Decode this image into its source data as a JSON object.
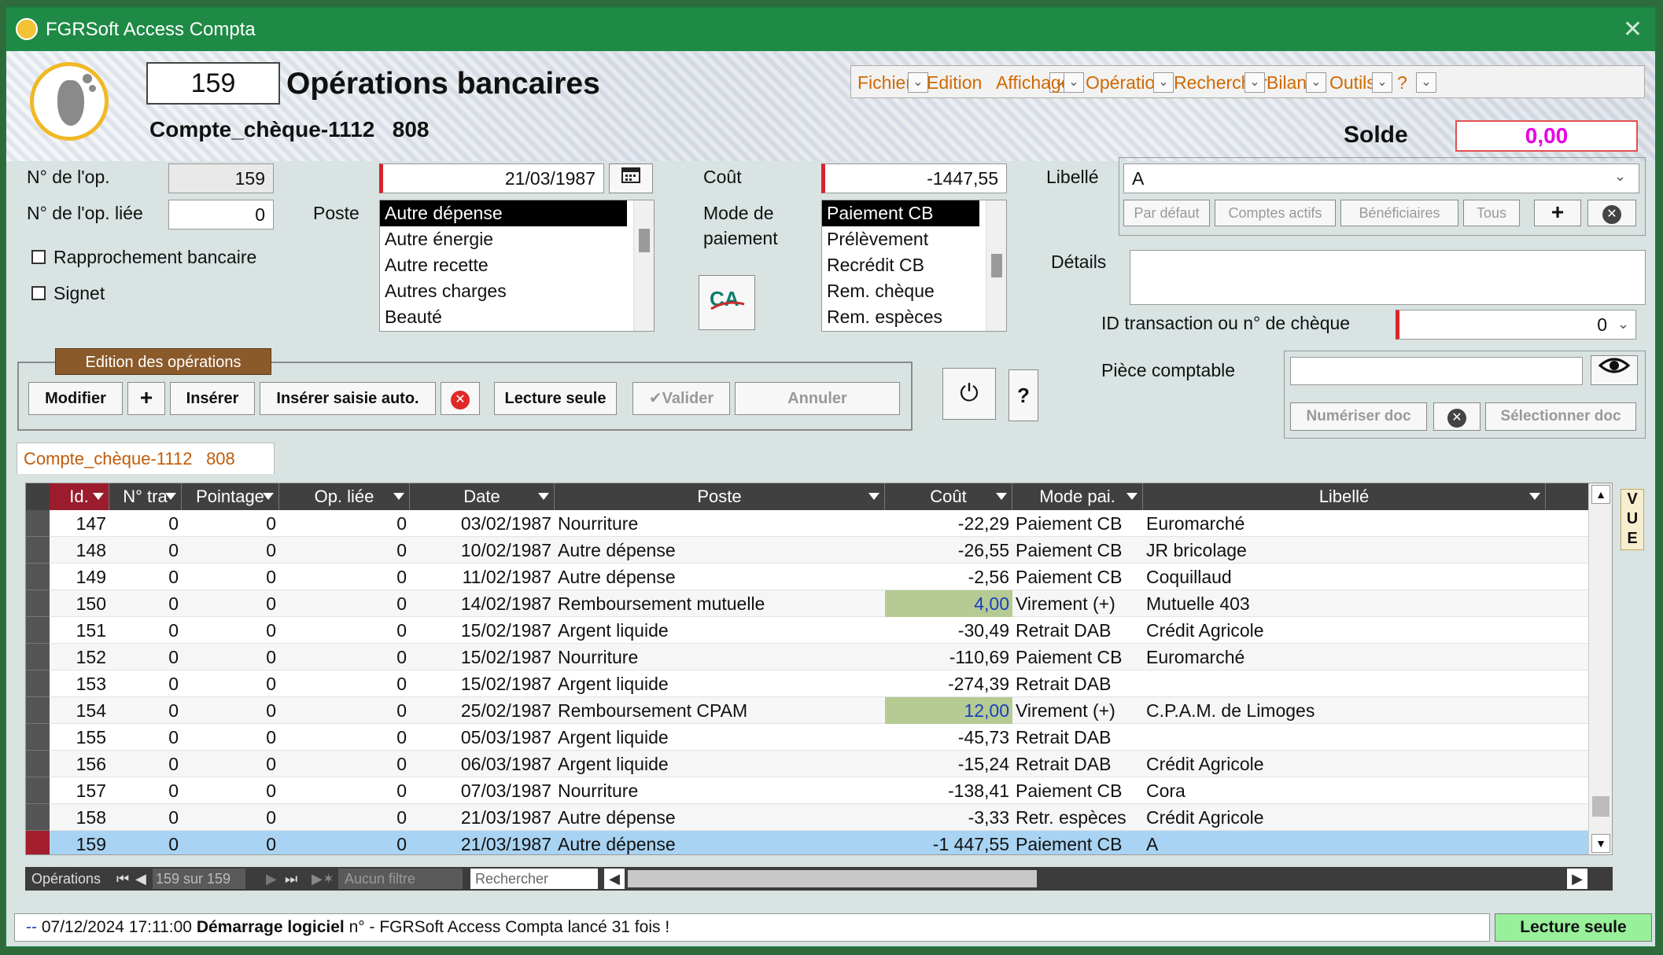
{
  "window": {
    "title": "FGRSoft Access Compta"
  },
  "header": {
    "op_number": "159",
    "title": "Opérations bancaires",
    "account": "Compte_chèque-1112    808",
    "solde_label": "Solde",
    "solde_value": "0,00"
  },
  "menu": [
    "Fichier",
    "Edition",
    "Affichage",
    "Opération",
    "Rechercher",
    "Bilans",
    "Outils",
    "?"
  ],
  "form": {
    "op_label": "N° de l'op.",
    "op_value": "159",
    "linked_label": "N° de l'op. liée",
    "linked_value": "0",
    "rapprochement_label": "Rapprochement bancaire",
    "signet_label": "Signet",
    "date_value": "21/03/1987",
    "poste_label": "Poste",
    "poste_items": [
      "Autre dépense",
      "Autre énergie",
      "Autre recette",
      "Autres charges",
      "Beauté"
    ],
    "cout_label": "Coût",
    "cout_value": "-1447,55",
    "mode_label_1": "Mode de",
    "mode_label_2": "paiement",
    "mode_items": [
      "Paiement CB",
      "Prélèvement",
      "Recrédit CB",
      "Rem. chèque",
      "Rem. espèces"
    ],
    "libelle_label": "Libellé",
    "libelle_value": "A",
    "libelle_buttons": [
      "Par défaut",
      "Comptes actifs",
      "Bénéficiaires",
      "Tous"
    ],
    "details_label": "Détails",
    "id_label": "ID transaction ou n° de chèque",
    "id_value": "0",
    "piece_label": "Pièce comptable",
    "numeriser": "Numériser doc",
    "selectionner": "Sélectionner doc"
  },
  "edit": {
    "group_title": "Edition des opérations",
    "modifier": "Modifier",
    "inserer": "Insérer",
    "inserer_auto": "Insérer saisie auto.",
    "lecture_seule": "Lecture seule",
    "valider": "Valider",
    "annuler": "Annuler",
    "help": "?"
  },
  "grid": {
    "tab_label": "Compte_chèque-1112    808",
    "columns": [
      "Id.",
      "N° tra",
      "Pointage",
      "Op. liée",
      "Date",
      "Poste",
      "Coût",
      "Mode pai.",
      "Libellé"
    ],
    "rows": [
      [
        "147",
        "0",
        "0",
        "0",
        "03/02/1987",
        "Nourriture",
        "-22,29",
        "Paiement CB",
        "Euromarché"
      ],
      [
        "148",
        "0",
        "0",
        "0",
        "10/02/1987",
        "Autre dépense",
        "-26,55",
        "Paiement CB",
        "JR bricolage"
      ],
      [
        "149",
        "0",
        "0",
        "0",
        "11/02/1987",
        "Autre dépense",
        "-2,56",
        "Paiement CB",
        "Coquillaud"
      ],
      [
        "150",
        "0",
        "0",
        "0",
        "14/02/1987",
        "Remboursement mutuelle",
        "4,00",
        "Virement (+)",
        "Mutuelle 403"
      ],
      [
        "151",
        "0",
        "0",
        "0",
        "15/02/1987",
        "Argent liquide",
        "-30,49",
        "Retrait DAB",
        "Crédit Agricole"
      ],
      [
        "152",
        "0",
        "0",
        "0",
        "15/02/1987",
        "Nourriture",
        "-110,69",
        "Paiement CB",
        "Euromarché"
      ],
      [
        "153",
        "0",
        "0",
        "0",
        "15/02/1987",
        "Argent liquide",
        "-274,39",
        "Retrait DAB",
        ""
      ],
      [
        "154",
        "0",
        "0",
        "0",
        "25/02/1987",
        "Remboursement CPAM",
        "12,00",
        "Virement (+)",
        "C.P.A.M. de Limoges"
      ],
      [
        "155",
        "0",
        "0",
        "0",
        "05/03/1987",
        "Argent liquide",
        "-45,73",
        "Retrait DAB",
        ""
      ],
      [
        "156",
        "0",
        "0",
        "0",
        "06/03/1987",
        "Argent liquide",
        "-15,24",
        "Retrait DAB",
        "Crédit Agricole"
      ],
      [
        "157",
        "0",
        "0",
        "0",
        "07/03/1987",
        "Nourriture",
        "-138,41",
        "Paiement CB",
        "Cora"
      ],
      [
        "158",
        "0",
        "0",
        "0",
        "21/03/1987",
        "Autre dépense",
        "-3,33",
        "Retr. espèces",
        "Crédit Agricole"
      ],
      [
        "159",
        "0",
        "0",
        "0",
        "21/03/1987",
        "Autre dépense",
        "-1 447,55",
        "Paiement CB",
        "A"
      ]
    ],
    "positive_rows": [
      3,
      7
    ],
    "selected_row": 12
  },
  "nav": {
    "label": "Opérations",
    "position": "159 sur 159",
    "filter": "Aucun filtre",
    "search_placeholder": "Rechercher"
  },
  "vue_letters": [
    "V",
    "U",
    "E"
  ],
  "status": {
    "prefix": "--",
    "datetime": "07/12/2024 17:11:00",
    "event": "Démarrage logiciel",
    "suffix": "n° -",
    "message": "FGRSoft Access Compta lancé 31 fois !",
    "mode": "Lecture seule"
  },
  "colors": {
    "titlebar": "#1e8a45",
    "menu_text": "#d06a00",
    "required_bar": "#d9232d",
    "selected_row": "#a9d3f2",
    "positive_cost_bg": "#b5cb93",
    "positive_cost_text": "#1a3ebf",
    "solde_text": "#e600e6",
    "status_mode_bg": "#98f09a"
  },
  "icons": [
    "app-icon",
    "calendar-icon",
    "credit-agricole-logo",
    "power-icon",
    "eye-icon",
    "plus-icon",
    "clear-icon",
    "checkmark-icon"
  ]
}
